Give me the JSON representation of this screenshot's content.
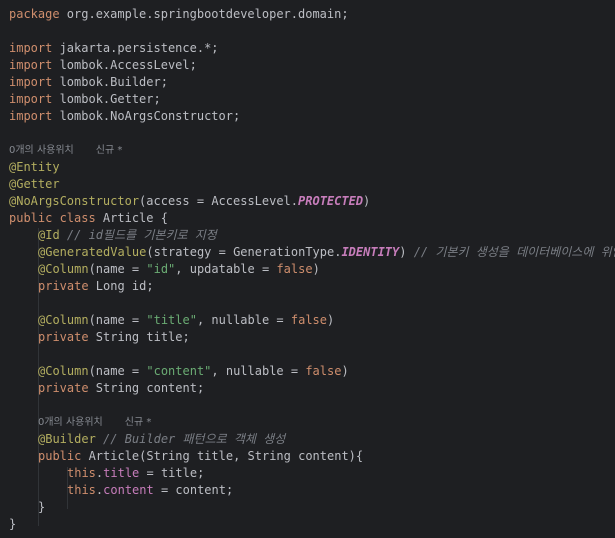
{
  "colors": {
    "background": "#1e1f22",
    "default": "#bcbec4",
    "keyword": "#cf8e6d",
    "annotation": "#b3ae60",
    "string": "#6aab73",
    "comment": "#7a7e85",
    "field": "#c77dbb",
    "hint": "#868a91"
  },
  "lines": [
    {
      "type": "code",
      "indent": 0,
      "tokens": [
        [
          "kw",
          "package"
        ],
        [
          "d",
          " org.example.springbootdeveloper.domain;"
        ]
      ]
    },
    {
      "type": "blank"
    },
    {
      "type": "code",
      "indent": 0,
      "tokens": [
        [
          "kw",
          "import"
        ],
        [
          "d",
          " jakarta.persistence.*;"
        ]
      ]
    },
    {
      "type": "code",
      "indent": 0,
      "tokens": [
        [
          "kw",
          "import"
        ],
        [
          "d",
          " lombok.AccessLevel;"
        ]
      ]
    },
    {
      "type": "code",
      "indent": 0,
      "tokens": [
        [
          "kw",
          "import"
        ],
        [
          "d",
          " lombok.Builder;"
        ]
      ]
    },
    {
      "type": "code",
      "indent": 0,
      "tokens": [
        [
          "kw",
          "import"
        ],
        [
          "d",
          " lombok.Getter;"
        ]
      ]
    },
    {
      "type": "code",
      "indent": 0,
      "tokens": [
        [
          "kw",
          "import"
        ],
        [
          "d",
          " lombok.NoArgsConstructor;"
        ]
      ]
    },
    {
      "type": "blank"
    },
    {
      "type": "hint",
      "indent": 0,
      "usages": "0개의 사용위치",
      "author": "신규 *"
    },
    {
      "type": "code",
      "indent": 0,
      "tokens": [
        [
          "an",
          "@Entity"
        ]
      ]
    },
    {
      "type": "code",
      "indent": 0,
      "tokens": [
        [
          "an",
          "@Getter"
        ]
      ]
    },
    {
      "type": "code",
      "indent": 0,
      "tokens": [
        [
          "an",
          "@NoArgsConstructor"
        ],
        [
          "d",
          "("
        ],
        [
          "d",
          "access"
        ],
        [
          "d",
          " = AccessLevel."
        ],
        [
          "fld",
          "PROTECTED"
        ],
        [
          "d",
          ")"
        ]
      ]
    },
    {
      "type": "code",
      "indent": 0,
      "tokens": [
        [
          "kw",
          "public class"
        ],
        [
          "d",
          " Article {"
        ]
      ]
    },
    {
      "type": "code",
      "indent": 1,
      "tokens": [
        [
          "an",
          "@Id"
        ],
        [
          "cm",
          " // id필드를 기본키로 지정"
        ]
      ]
    },
    {
      "type": "code",
      "indent": 1,
      "tokens": [
        [
          "an",
          "@GeneratedValue"
        ],
        [
          "d",
          "(strategy = GenerationType."
        ],
        [
          "fld",
          "IDENTITY"
        ],
        [
          "d",
          ")"
        ],
        [
          "cm",
          " // 기본키 생성을 데이터베이스에 위임"
        ]
      ]
    },
    {
      "type": "code",
      "indent": 1,
      "tokens": [
        [
          "an",
          "@Column"
        ],
        [
          "d",
          "(name = "
        ],
        [
          "str",
          "\"id\""
        ],
        [
          "d",
          ", updatable = "
        ],
        [
          "kw",
          "false"
        ],
        [
          "d",
          ")"
        ]
      ]
    },
    {
      "type": "code",
      "indent": 1,
      "tokens": [
        [
          "kw",
          "private"
        ],
        [
          "d",
          " Long id;"
        ]
      ]
    },
    {
      "type": "blank"
    },
    {
      "type": "code",
      "indent": 1,
      "tokens": [
        [
          "an",
          "@Column"
        ],
        [
          "d",
          "(name = "
        ],
        [
          "str",
          "\"title\""
        ],
        [
          "d",
          ", nullable = "
        ],
        [
          "kw",
          "false"
        ],
        [
          "d",
          ")"
        ]
      ]
    },
    {
      "type": "code",
      "indent": 1,
      "tokens": [
        [
          "kw",
          "private"
        ],
        [
          "d",
          " String title;"
        ]
      ]
    },
    {
      "type": "blank"
    },
    {
      "type": "code",
      "indent": 1,
      "tokens": [
        [
          "an",
          "@Column"
        ],
        [
          "d",
          "(name = "
        ],
        [
          "str",
          "\"content\""
        ],
        [
          "d",
          ", nullable = "
        ],
        [
          "kw",
          "false"
        ],
        [
          "d",
          ")"
        ]
      ]
    },
    {
      "type": "code",
      "indent": 1,
      "tokens": [
        [
          "kw",
          "private"
        ],
        [
          "d",
          " String content;"
        ]
      ]
    },
    {
      "type": "blank"
    },
    {
      "type": "hint",
      "indent": 1,
      "usages": "0개의 사용위치",
      "author": "신규 *"
    },
    {
      "type": "code",
      "indent": 1,
      "tokens": [
        [
          "an",
          "@Builder"
        ],
        [
          "cm",
          " // Builder 패턴으로 객체 생성"
        ]
      ]
    },
    {
      "type": "code",
      "indent": 1,
      "tokens": [
        [
          "kw",
          "public"
        ],
        [
          "d",
          " Article(String title, String content){"
        ]
      ]
    },
    {
      "type": "code",
      "indent": 2,
      "tokens": [
        [
          "kw",
          "this"
        ],
        [
          "d",
          "."
        ],
        [
          "fld",
          "title"
        ],
        [
          "d",
          " = title;"
        ]
      ]
    },
    {
      "type": "code",
      "indent": 2,
      "tokens": [
        [
          "kw",
          "this"
        ],
        [
          "d",
          "."
        ],
        [
          "fld",
          "content"
        ],
        [
          "d",
          " = content;"
        ]
      ]
    },
    {
      "type": "code",
      "indent": 1,
      "tokens": [
        [
          "d",
          "}"
        ]
      ]
    },
    {
      "type": "code",
      "indent": 0,
      "tokens": [
        [
          "d",
          "}"
        ]
      ]
    }
  ]
}
